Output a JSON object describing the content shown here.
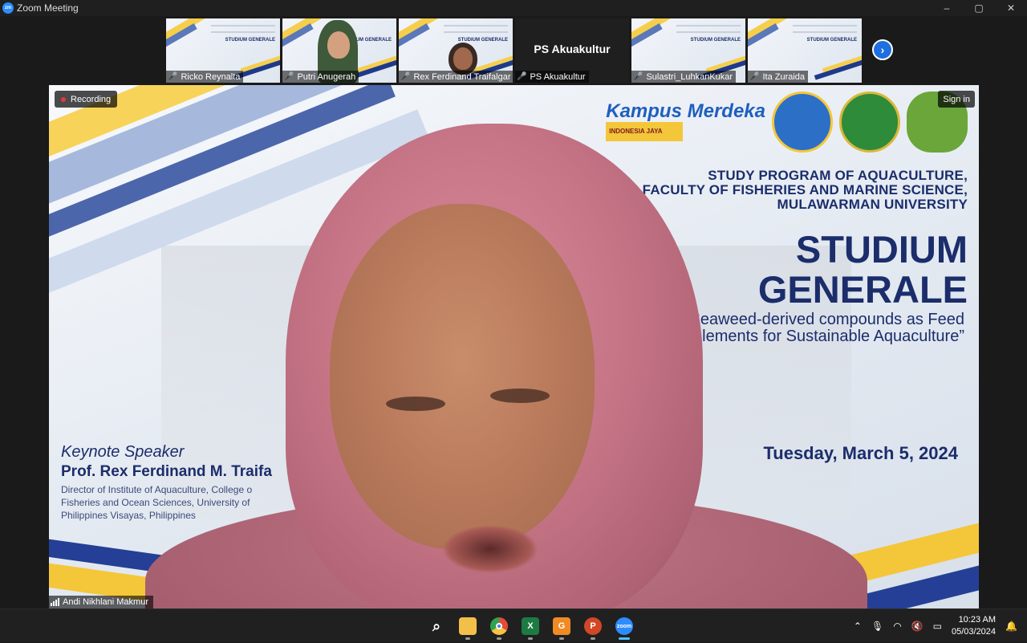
{
  "window": {
    "title": "Zoom Meeting",
    "app_icon_text": "zm",
    "minimize": "–",
    "maximize": "▢",
    "close": "✕"
  },
  "participants": [
    {
      "name": "Ricko Reynalta",
      "video": "slide"
    },
    {
      "name": "Putri Anugerah",
      "video": "camera"
    },
    {
      "name": "Rex Ferdinand Traifalgar",
      "video": "camera-slide"
    },
    {
      "name": "PS Akuakultur",
      "video": "off",
      "display_name": "PS Akuakultur"
    },
    {
      "name": "Sulastri_LuhkanKukar",
      "video": "slide"
    },
    {
      "name": "Ita Zuraida",
      "video": "slide"
    }
  ],
  "thumb_slide_title": "STUDIUM GENERALE",
  "next_icon": "›",
  "main": {
    "recording": "Recording",
    "sign_in": "Sign in",
    "speaker_name": "Andi Nikhlani Makmur"
  },
  "slide": {
    "kampus": "Kampus Merdeka",
    "kampus_tag": "INDONESIA JAYA",
    "university_lines": [
      "STUDY PROGRAM OF AQUACULTURE,",
      "FACULTY OF FISHERIES AND MARINE SCIENCE,",
      "MULAWARMAN UNIVERSITY"
    ],
    "title_lines": [
      "STUDIUM",
      "GENERALE"
    ],
    "subtitle_lines": [
      "“Seaweed-derived compounds as Feed",
      "Supplements for Sustainable Aquaculture”"
    ],
    "date": "Tuesday, March 5, 2024",
    "keynote_label": "Keynote Speaker",
    "keynote_name": "Prof. Rex Ferdinand M. Traifa",
    "keynote_desc": [
      "Director of Institute of Aquaculture, College o",
      "Fisheries and Ocean Sciences, University of",
      "Philippines Visayas, Philippines"
    ]
  },
  "taskbar": {
    "apps": [
      {
        "name": "start",
        "icon": "windows-icon",
        "color": "#3b9cf0"
      },
      {
        "name": "search",
        "icon": "search-icon",
        "color": "transparent"
      },
      {
        "name": "explorer",
        "icon": "folder-icon",
        "color": "#f2c04a"
      },
      {
        "name": "chrome",
        "icon": "chrome-icon",
        "color": "#e24c3b"
      },
      {
        "name": "excel",
        "icon": "excel-icon",
        "color": "#1d7a43"
      },
      {
        "name": "gdrive",
        "icon": "app-g-icon",
        "color": "#f08a24"
      },
      {
        "name": "powerpoint",
        "icon": "powerpoint-icon",
        "color": "#d24726"
      },
      {
        "name": "zoom",
        "icon": "zoom-icon",
        "color": "#2d8cff"
      }
    ],
    "clock_time": "10:23 AM",
    "clock_date": "05/03/2024"
  }
}
